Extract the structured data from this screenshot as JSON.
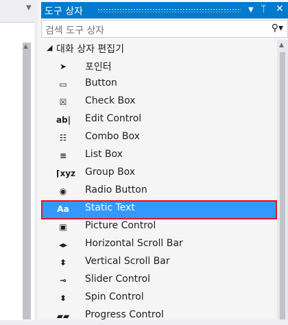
{
  "toolbox": {
    "title": "도구 상자",
    "pin_glyph": "▾",
    "autohide_glyph": "ᛘ",
    "close_glyph": "✕",
    "search_placeholder": "검색 도구 상자",
    "search_icon": "search-icon",
    "group": {
      "label": "대화 상자 편집기",
      "items": [
        {
          "label": "포인터",
          "icon": "pointer-icon",
          "glyph": "➤"
        },
        {
          "label": "Button",
          "icon": "button-icon",
          "glyph": "▭"
        },
        {
          "label": "Check Box",
          "icon": "checkbox-icon",
          "glyph": "☒"
        },
        {
          "label": "Edit Control",
          "icon": "edit-control-icon",
          "glyph": "ab|"
        },
        {
          "label": "Combo Box",
          "icon": "combo-box-icon",
          "glyph": "☷"
        },
        {
          "label": "List Box",
          "icon": "list-box-icon",
          "glyph": "≡"
        },
        {
          "label": "Group Box",
          "icon": "group-box-icon",
          "glyph": "⌈xyz"
        },
        {
          "label": "Radio Button",
          "icon": "radio-button-icon",
          "glyph": "◉"
        },
        {
          "label": "Static Text",
          "icon": "static-text-icon",
          "glyph": "Aa"
        },
        {
          "label": "Picture Control",
          "icon": "picture-control-icon",
          "glyph": "▣"
        },
        {
          "label": "Horizontal Scroll Bar",
          "icon": "horizontal-scrollbar-icon",
          "glyph": "◂▸"
        },
        {
          "label": "Vertical Scroll Bar",
          "icon": "vertical-scrollbar-icon",
          "glyph": "⬍"
        },
        {
          "label": "Slider Control",
          "icon": "slider-control-icon",
          "glyph": "⊸"
        },
        {
          "label": "Spin Control",
          "icon": "spin-control-icon",
          "glyph": "⬍"
        },
        {
          "label": "Progress Control",
          "icon": "progress-control-icon",
          "glyph": "▰▰"
        }
      ]
    },
    "selected_index": 8
  },
  "colors": {
    "title_bar": "#007acc",
    "selection": "#3399ff",
    "highlight_border": "#e81123"
  }
}
